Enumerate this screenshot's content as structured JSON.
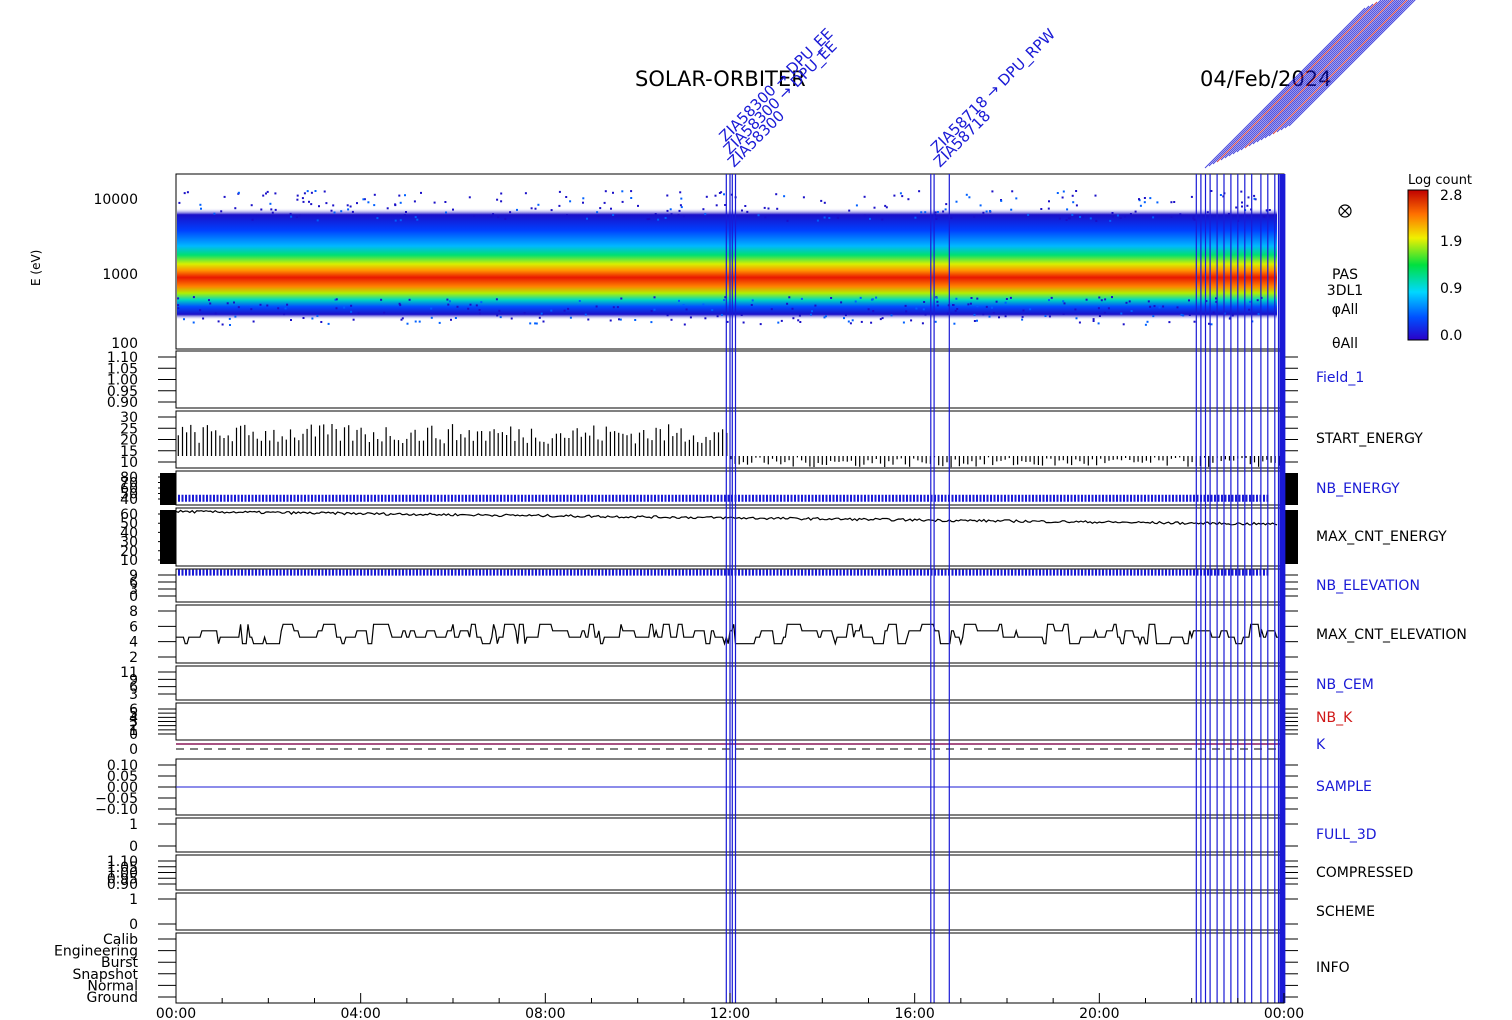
{
  "header": {
    "title": "SOLAR-ORBITER",
    "date": "04/Feb/2024"
  },
  "colors": {
    "black": "#000000",
    "blue": "#1a1ad6",
    "red": "#d01818",
    "purple": "#8b1a5a"
  },
  "spectrogram": {
    "ylabel": "E (eV)",
    "yticks": [
      "10000",
      "1000",
      "100"
    ],
    "side_labels": [
      "PAS",
      "3DL1",
      "φAll",
      "θAll"
    ],
    "colorbar": {
      "title": "Log count",
      "ticks": [
        "2.8",
        "1.9",
        "0.9",
        "0.0"
      ]
    }
  },
  "xaxis": {
    "ticks": [
      "00:00",
      "04:00",
      "08:00",
      "12:00",
      "16:00",
      "20:00",
      "00:00"
    ]
  },
  "event_labels": {
    "group1": [
      "ZIA58300",
      "ZIA58300 → DPU_EE",
      "ZIA58300 → DPU_EE"
    ],
    "group2": [
      "ZIA58718",
      "ZIA58718 → DPU_RPW"
    ]
  },
  "chart_data": [
    {
      "type": "heatmap",
      "name": "spectrogram",
      "ylabel": "E (eV)",
      "yscale": "log",
      "ylim": [
        100,
        20000
      ],
      "xlim": [
        "00:00",
        "24:00"
      ],
      "colorbar": {
        "title": "Log count",
        "range": [
          0.0,
          2.8
        ]
      },
      "peak_energy_band_eV": [
        700,
        1500
      ]
    },
    {
      "type": "line",
      "name": "Field_1",
      "yticks": [
        "1.10",
        "1.05",
        "1.00",
        "0.95",
        "0.90"
      ],
      "values_constant": 1.0
    },
    {
      "type": "bar",
      "name": "START_ENERGY",
      "yticks": [
        "30",
        "25",
        "20",
        "15",
        "10"
      ],
      "ylim": [
        10,
        30
      ],
      "typical_before_noon": 22,
      "typical_after_noon": 12
    },
    {
      "type": "line",
      "name": "NB_ENERGY",
      "yticks": [
        "80",
        "70",
        "60",
        "50",
        "40"
      ],
      "ylim": [
        40,
        80
      ],
      "value": 48
    },
    {
      "type": "line",
      "name": "MAX_CNT_ENERGY",
      "yticks": [
        "60",
        "50",
        "40",
        "30",
        "20",
        "10"
      ],
      "ylim": [
        10,
        60
      ],
      "value_start": 57,
      "value_end": 46
    },
    {
      "type": "line",
      "name": "NB_ELEVATION",
      "yticks": [
        "9",
        "6",
        "3",
        "0"
      ],
      "ylim": [
        0,
        9
      ],
      "value": 8
    },
    {
      "type": "line",
      "name": "MAX_CNT_ELEVATION",
      "yticks": [
        "8",
        "6",
        "4",
        "2"
      ],
      "ylim": [
        0,
        9
      ],
      "range": [
        2,
        7
      ]
    },
    {
      "type": "line",
      "name": "NB_CEM",
      "yticks": [
        "11",
        "9",
        "6",
        "3"
      ],
      "ylim": [
        0,
        11
      ]
    },
    {
      "type": "line",
      "name": "NB_K",
      "yticks": [
        "6",
        "5",
        "4",
        "3",
        "2",
        "1",
        "0"
      ],
      "ylim": [
        0,
        6
      ],
      "value": 1
    },
    {
      "type": "line",
      "name": "K",
      "value": 0
    },
    {
      "type": "line",
      "name": "SAMPLE",
      "yticks": [
        "0.10",
        "0.05",
        "0.00",
        "−0.05",
        "−0.10"
      ],
      "ylim": [
        -0.1,
        0.1
      ],
      "value": 0.0
    },
    {
      "type": "line",
      "name": "FULL_3D",
      "yticks": [
        "1",
        "0"
      ],
      "ylim": [
        0,
        1
      ]
    },
    {
      "type": "line",
      "name": "COMPRESSED",
      "yticks": [
        "1.10",
        "1.05",
        "1.00",
        "0.95",
        "0.90"
      ],
      "ylim": [
        0.9,
        1.1
      ]
    },
    {
      "type": "line",
      "name": "SCHEME",
      "yticks": [
        "1",
        "0"
      ],
      "ylim": [
        0,
        1
      ]
    },
    {
      "type": "line",
      "name": "INFO",
      "yticks": [
        "Calib",
        "Engineering",
        "Burst",
        "Snapshot",
        "Normal",
        "Ground"
      ]
    }
  ],
  "event_times_hours": [
    11.92,
    12.0,
    12.05,
    12.12,
    16.35,
    16.42,
    16.75,
    22.1,
    22.2,
    22.3,
    22.4,
    22.55,
    22.7,
    22.85,
    23.0,
    23.15,
    23.3,
    23.5,
    23.65,
    23.8,
    23.88,
    23.95,
    24.0
  ]
}
